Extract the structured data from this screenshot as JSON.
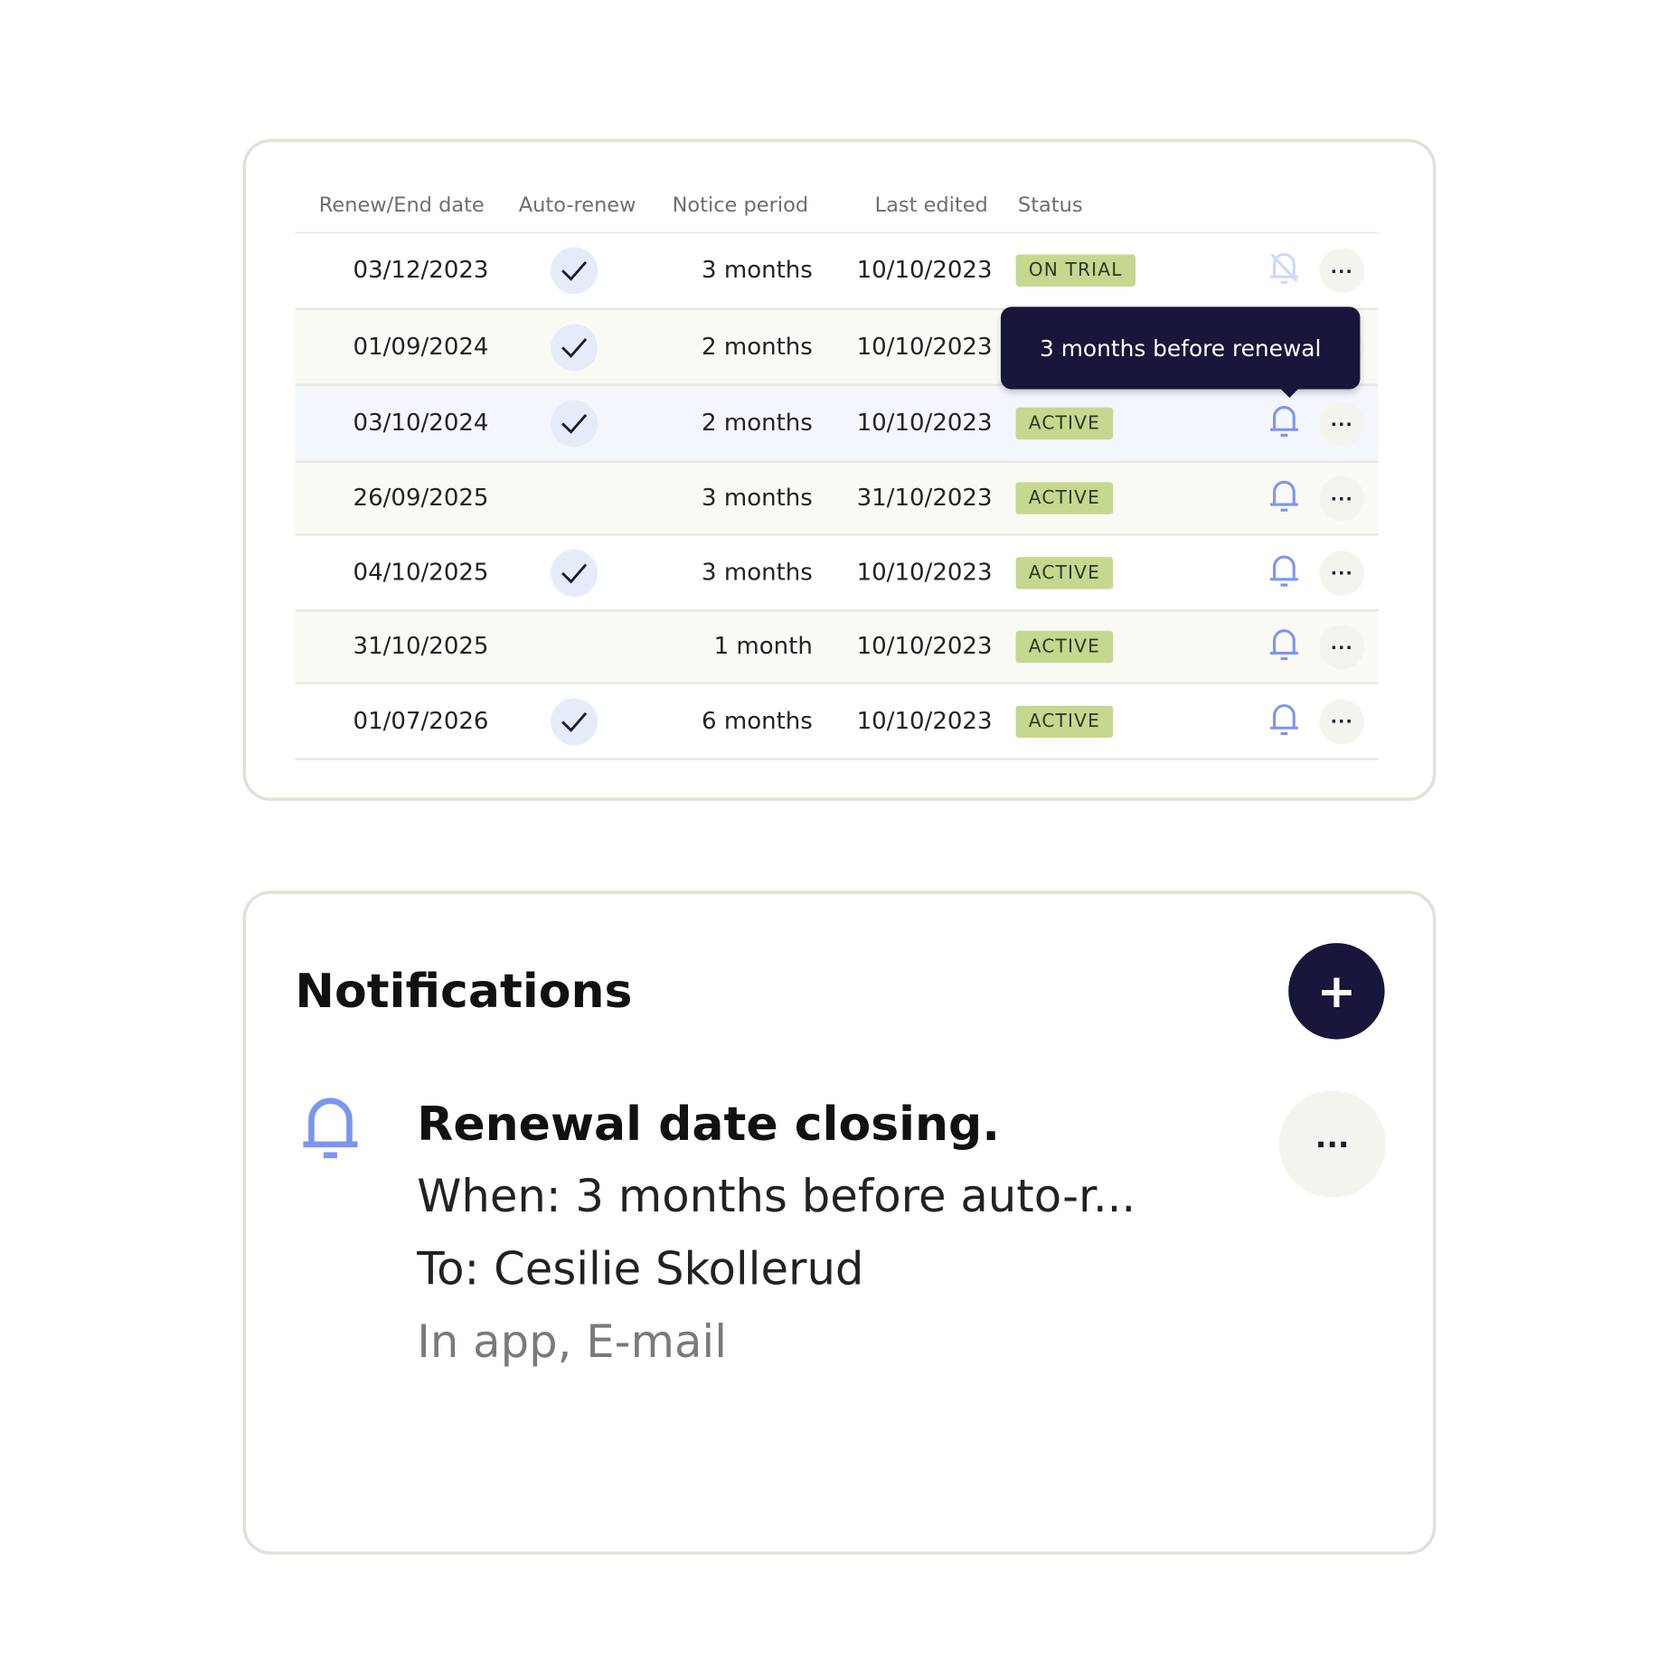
{
  "table": {
    "headers": [
      "Renew/End date",
      "Auto-renew",
      "Notice period",
      "Last edited",
      "Status"
    ],
    "rows": [
      {
        "date": "03/12/2023",
        "auto_renew": true,
        "notice": "3 months",
        "edited": "10/10/2023",
        "status": "ON TRIAL",
        "bell": "bell-off-icon"
      },
      {
        "date": "01/09/2024",
        "auto_renew": true,
        "notice": "2 months",
        "edited": "10/10/2023",
        "status": "",
        "bell": "bell-icon"
      },
      {
        "date": "03/10/2024",
        "auto_renew": true,
        "notice": "2 months",
        "edited": "10/10/2023",
        "status": "ACTIVE",
        "bell": "bell-icon"
      },
      {
        "date": "26/09/2025",
        "auto_renew": false,
        "notice": "3 months",
        "edited": "31/10/2023",
        "status": "ACTIVE",
        "bell": "bell-icon"
      },
      {
        "date": "04/10/2025",
        "auto_renew": true,
        "notice": "3 months",
        "edited": "10/10/2023",
        "status": "ACTIVE",
        "bell": "bell-icon"
      },
      {
        "date": "31/10/2025",
        "auto_renew": false,
        "notice": "1 month",
        "edited": "10/10/2023",
        "status": "ACTIVE",
        "bell": "bell-icon"
      },
      {
        "date": "01/07/2026",
        "auto_renew": true,
        "notice": "6 months",
        "edited": "10/10/2023",
        "status": "ACTIVE",
        "bell": "bell-icon"
      }
    ],
    "more_label": "···",
    "tooltip": "3 months before renewal"
  },
  "notifications": {
    "title": "Notifications",
    "add_label": "+",
    "item": {
      "title": "Renewal date closing.",
      "when": "When: 3 months before auto-r...",
      "to": "To: Cesilie Skollerud",
      "channels": "In app, E-mail",
      "more_label": "···"
    }
  },
  "colors": {
    "accent": "#18163a",
    "bell": "#7b96f0",
    "badge": "#c6d78f",
    "hover_row": "#f3f6fd",
    "alt_row": "#fafaf5"
  }
}
